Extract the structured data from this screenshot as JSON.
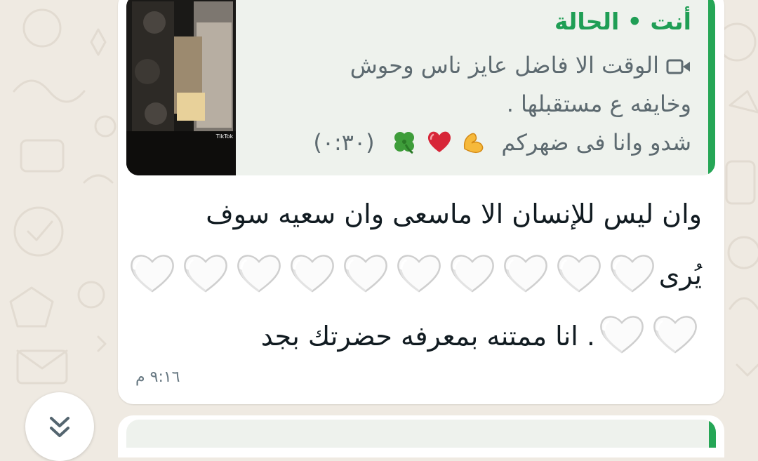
{
  "quoted_status": {
    "sender": "أنت",
    "separator": "•",
    "label": "الحالة",
    "media_icon": "video-camera-icon",
    "thumbnail_watermark": "TikTok",
    "line1": "الوقت الا فاضل عايز ناس وحوش",
    "line2": "وخايفه ع مستقبلها .",
    "line3": "شدو وانا فى ضهركم",
    "emojis": [
      "flexed-biceps",
      "red-heart",
      "four-leaf-clover"
    ],
    "duration": "(٠:٣٠)"
  },
  "message": {
    "line1": "وان ليس للإنسان الا ماسعى وان سعيه سوف",
    "line2_word": "يُرى",
    "line2_heart_count": 10,
    "line3_heart_count": 2,
    "line3_text": ". انا ممتنه بمعرفه حضرتك بجد",
    "heart_icon": "white-heart-icon"
  },
  "timestamp": "٩:١٦ م",
  "scroll_button_icon": "chevron-double-down-icon",
  "colors": {
    "accent_green": "#25a656",
    "title_green": "#1f9e55",
    "chat_background": "#efeae2",
    "quote_background": "#eef2ed"
  }
}
